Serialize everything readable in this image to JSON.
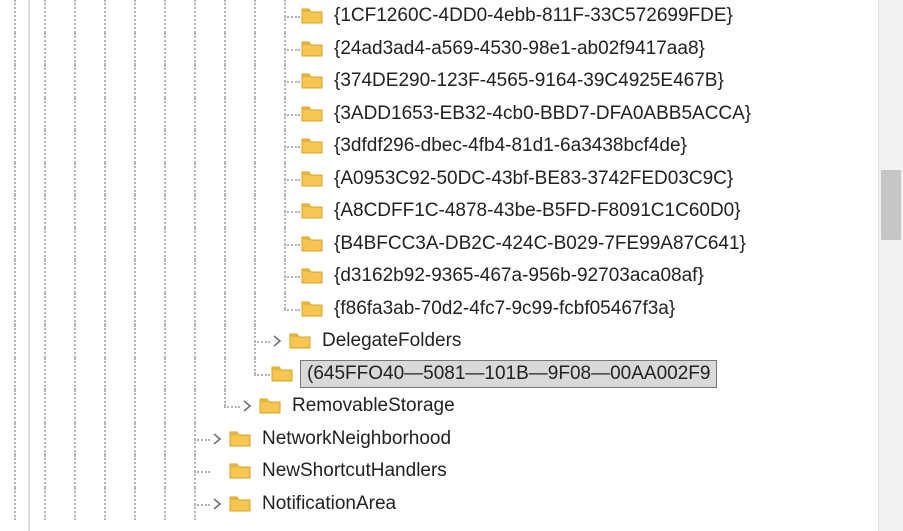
{
  "tree": {
    "guid_siblings": [
      "{1CF1260C-4DD0-4ebb-811F-33C572699FDE}",
      "{24ad3ad4-a569-4530-98e1-ab02f9417aa8}",
      "{374DE290-123F-4565-9164-39C4925E467B}",
      "{3ADD1653-EB32-4cb0-BBD7-DFA0ABB5ACCA}",
      "{3dfdf296-dbec-4fb4-81d1-6a3438bcf4de}",
      "{A0953C92-50DC-43bf-BE83-3742FED03C9C}",
      "{A8CDFF1C-4878-43be-B5FD-F8091C1C60D0}",
      "{B4BFCC3A-DB2C-424C-B029-7FE99A87C641}",
      "{d3162b92-9365-467a-956b-92703aca08af}",
      "{f86fa3ab-70d2-4fc7-9c99-fcbf05467f3a}"
    ],
    "delegate_folders_label": "DelegateFolders",
    "delegate_new_key": "(645FFO40—5081—101B—9F08—00AA002F9",
    "removable_storage_label": "RemovableStorage",
    "network_neighborhood_label": "NetworkNeighborhood",
    "new_shortcut_handlers_label": "NewShortcutHandlers",
    "notification_area_label": "NotificationArea"
  }
}
